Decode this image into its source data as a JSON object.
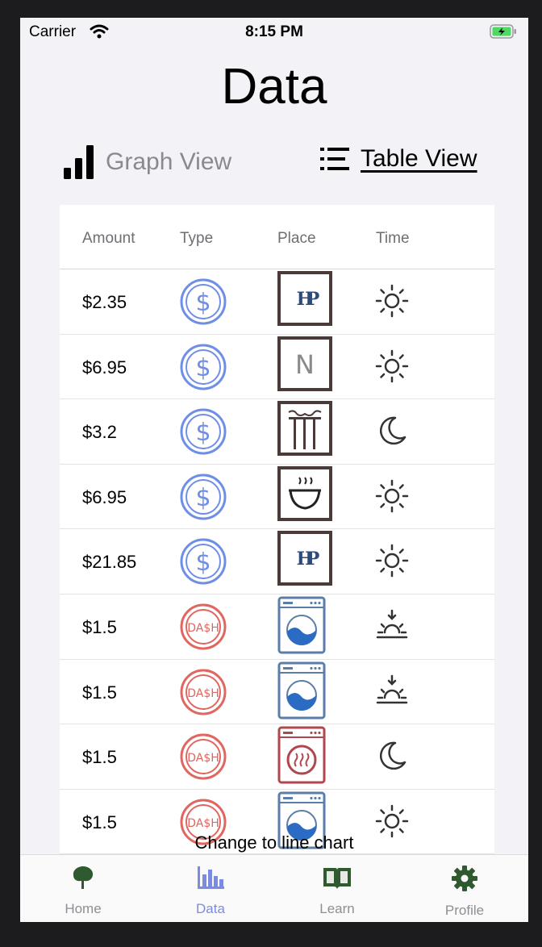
{
  "status_bar": {
    "carrier": "Carrier",
    "time": "8:15 PM"
  },
  "page": {
    "title": "Data"
  },
  "view_toggle": {
    "graph_label": "Graph View",
    "table_label": "Table View",
    "selected": "Table View"
  },
  "table": {
    "headers": [
      "Amount",
      "Type",
      "Place",
      "Time"
    ],
    "rows": [
      {
        "amount": "$2.35",
        "type": "dollar-icon",
        "place": "hp-logo",
        "time": "sun-icon"
      },
      {
        "amount": "$6.95",
        "type": "dollar-icon",
        "place": "n-logo",
        "time": "sun-icon"
      },
      {
        "amount": "$3.2",
        "type": "dollar-icon",
        "place": "pillar-logo",
        "time": "moon-icon"
      },
      {
        "amount": "$6.95",
        "type": "dollar-icon",
        "place": "bowl-logo",
        "time": "sun-icon"
      },
      {
        "amount": "$21.85",
        "type": "dollar-icon",
        "place": "hp-logo",
        "time": "sun-icon"
      },
      {
        "amount": "$1.5",
        "type": "dash-icon",
        "place": "washer-icon",
        "time": "sunset-icon"
      },
      {
        "amount": "$1.5",
        "type": "dash-icon",
        "place": "washer-icon",
        "time": "sunset-icon"
      },
      {
        "amount": "$1.5",
        "type": "dash-icon",
        "place": "dryer-icon",
        "time": "moon-icon"
      },
      {
        "amount": "$1.5",
        "type": "dash-icon",
        "place": "washer-icon",
        "time": "sun-icon"
      }
    ]
  },
  "chart_link": "Change to line chart",
  "tabbar": {
    "items": [
      {
        "label": "Home",
        "icon": "tree-icon"
      },
      {
        "label": "Data",
        "icon": "bar-chart-icon",
        "active": true
      },
      {
        "label": "Learn",
        "icon": "book-icon"
      },
      {
        "label": "Profile",
        "icon": "gear-icon"
      }
    ]
  },
  "colors": {
    "accent": "#7b8ce0",
    "dollar": "#6f8fe6",
    "dash": "#e06660",
    "tab_green": "#2f5a2f",
    "place_frame": "#4a3a38"
  }
}
